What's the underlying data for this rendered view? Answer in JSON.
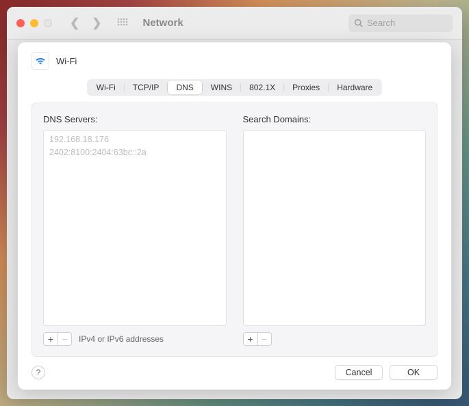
{
  "window": {
    "title": "Network",
    "search_placeholder": "Search"
  },
  "sheet": {
    "interface_label": "Wi-Fi",
    "tabs": [
      {
        "label": "Wi-Fi"
      },
      {
        "label": "TCP/IP"
      },
      {
        "label": "DNS"
      },
      {
        "label": "WINS"
      },
      {
        "label": "802.1X"
      },
      {
        "label": "Proxies"
      },
      {
        "label": "Hardware"
      }
    ],
    "selected_tab": "DNS"
  },
  "dns": {
    "servers_label": "DNS Servers:",
    "servers": [
      "192.168.18.176",
      "2402:8100:2404:63bc::2a"
    ],
    "servers_hint": "IPv4 or IPv6 addresses",
    "domains_label": "Search Domains:",
    "domains": []
  },
  "buttons": {
    "add": "+",
    "remove": "−",
    "help": "?",
    "cancel": "Cancel",
    "ok": "OK"
  }
}
